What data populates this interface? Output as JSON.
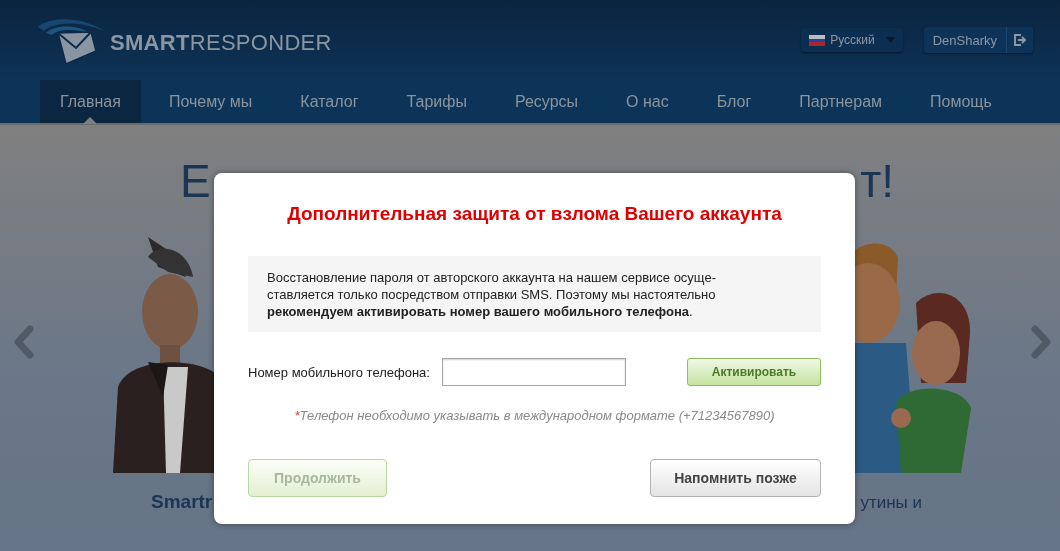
{
  "header": {
    "logo": "**SMART**RESPONDER",
    "language": {
      "label": "Русский"
    },
    "user": {
      "name": "DenSharky"
    }
  },
  "nav": [
    {
      "label": "Главная",
      "selected": true
    },
    {
      "label": "Почему мы",
      "selected": false
    },
    {
      "label": "Каталог",
      "selected": false
    },
    {
      "label": "Тарифы",
      "selected": false
    },
    {
      "label": "Ресурсы",
      "selected": false
    },
    {
      "label": "О нас",
      "selected": false
    },
    {
      "label": "Блог",
      "selected": false
    },
    {
      "label": "Партнерам",
      "selected": false
    },
    {
      "label": "Помощь",
      "selected": false
    }
  ],
  "hero": {
    "heading_left": "E",
    "heading_right": "т!",
    "caption_left": "Smartr",
    "caption_right": "утины и"
  },
  "modal": {
    "title": "Дополнительная защита от взлома Вашего аккаунта",
    "notice": "Восстановление пароля от авторского аккаунта на нашем сервисе осуще-\nставляется только посредством отправки SMS. Поэтому мы настоятельно\n**рекомендуем активировать номер вашего мобильного телефона**.",
    "phone_label": "Номер мобильного телефона:",
    "activate_button": "Активировать",
    "required_mark": "*",
    "hint": "Телефон необходимо указывать в международном формате (+71234567890)",
    "continue_button": {
      "label": "Продолжить",
      "disabled": true
    },
    "later_button": {
      "label": "Напомнить позже",
      "disabled": false
    }
  }
}
